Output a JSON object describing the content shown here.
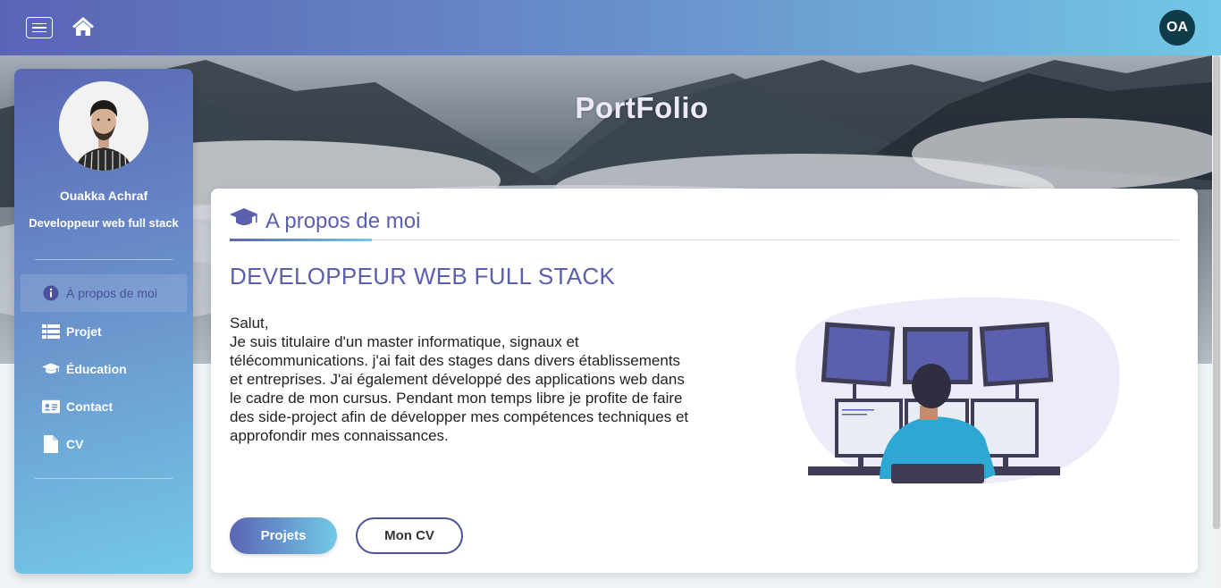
{
  "topbar": {
    "menu_icon": "hamburger-menu-icon",
    "home_icon": "home-icon",
    "avatar_initials": "OA"
  },
  "hero": {
    "title": "PortFolio"
  },
  "sidebar": {
    "name": "Ouakka Achraf",
    "role": "Developpeur web full stack",
    "items": [
      {
        "label": "À propos de moi",
        "icon": "info-circle-icon",
        "active": true
      },
      {
        "label": "Projet",
        "icon": "list-icon",
        "active": false
      },
      {
        "label": "Éducation",
        "icon": "graduation-cap-icon",
        "active": false
      },
      {
        "label": "Contact",
        "icon": "id-card-icon",
        "active": false
      },
      {
        "label": "CV",
        "icon": "file-icon",
        "active": false
      }
    ]
  },
  "about": {
    "heading": "A propos de moi",
    "heading_icon": "graduation-cap-icon",
    "subtitle": "DEVELOPPEUR WEB FULL STACK",
    "greeting": "Salut,",
    "body": "Je suis titulaire d'un master informatique, signaux et télécommunications. j'ai fait des stages dans divers établissements et entreprises. J'ai également développé des applications web dans le cadre de mon cursus. Pendant mon temps libre je profite de faire des side-project afin de développer mes compétences techniques et approfondir mes connaissances.",
    "btn_projects": "Projets",
    "btn_cv": "Mon CV"
  },
  "colors": {
    "primary": "#5a64b5",
    "secondary": "#73c9e7",
    "heading": "#5a5fae"
  }
}
